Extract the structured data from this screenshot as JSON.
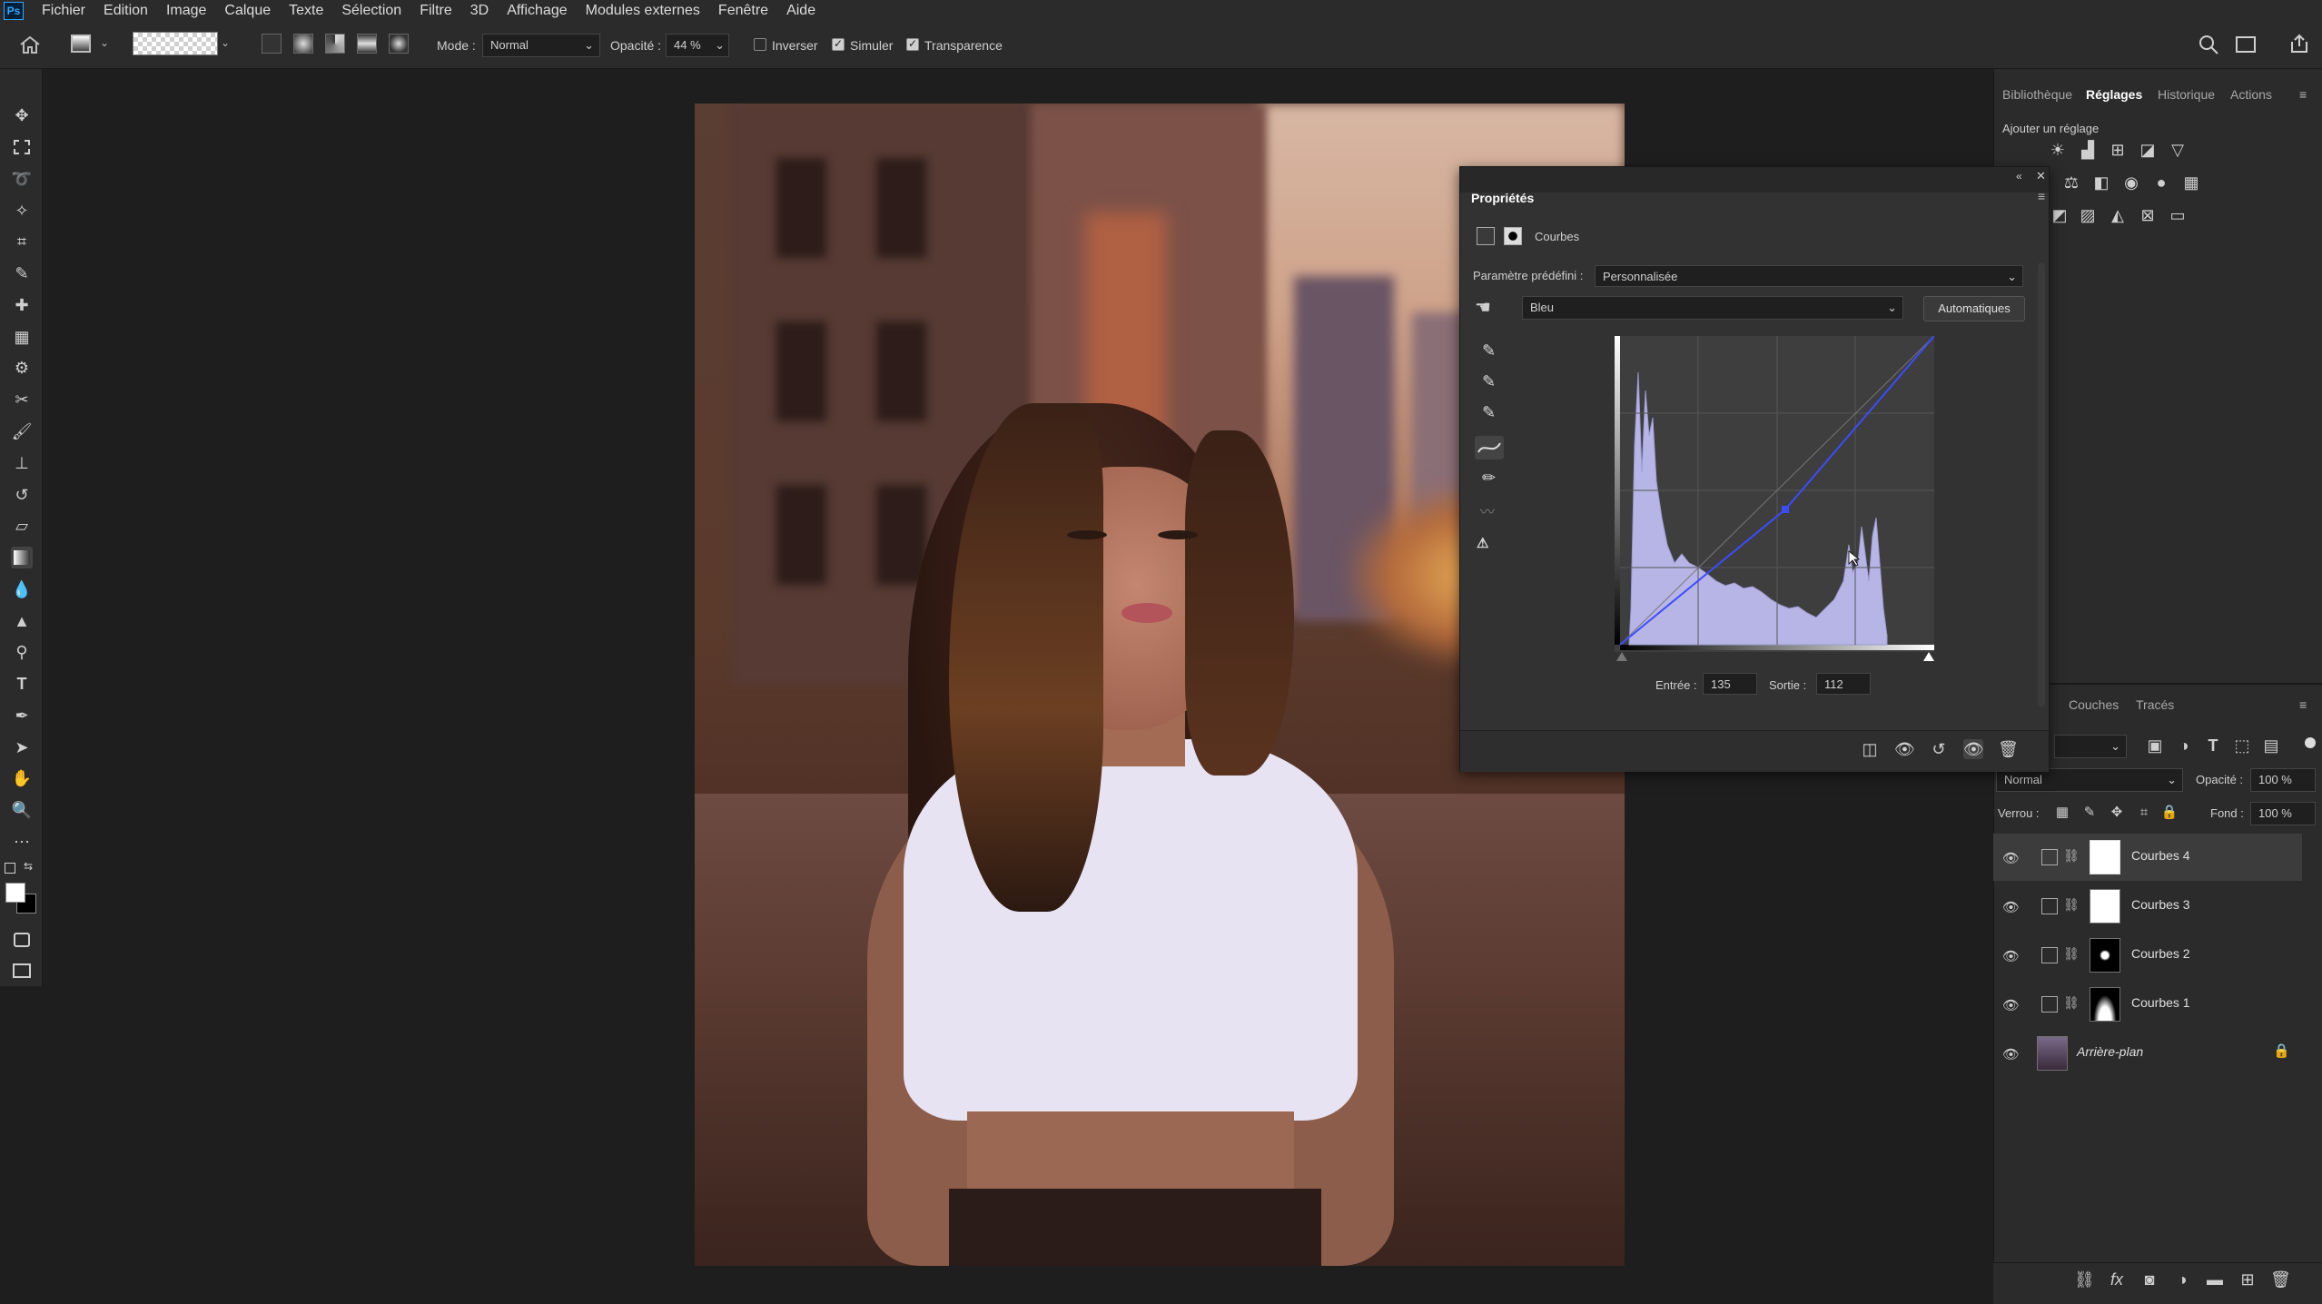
{
  "menubar": {
    "logo": "Ps",
    "items": [
      "Fichier",
      "Edition",
      "Image",
      "Calque",
      "Texte",
      "Sélection",
      "Filtre",
      "3D",
      "Affichage",
      "Modules externes",
      "Fenêtre",
      "Aide"
    ]
  },
  "options": {
    "mode_label": "Mode :",
    "mode_value": "Normal",
    "opacity_label": "Opacité :",
    "opacity_value": "44 %",
    "invert_label": "Inverser",
    "simulate_label": "Simuler",
    "transparency_label": "Transparence",
    "invert_checked": false,
    "simulate_checked": true,
    "transparency_checked": true
  },
  "right_panel": {
    "tabs": [
      "Bibliothèque",
      "Réglages",
      "Historique",
      "Actions"
    ],
    "active_tab": "Réglages",
    "add_adjustment": "Ajouter un réglage"
  },
  "properties": {
    "title": "Propriétés",
    "adjustment_name": "Courbes",
    "preset_label": "Paramètre prédéfini :",
    "preset_value": "Personnalisée",
    "channel_value": "Bleu",
    "auto_button": "Automatiques",
    "input_label": "Entrée :",
    "input_value": "135",
    "output_label": "Sortie :",
    "output_value": "112",
    "curve_point": {
      "input": 135,
      "output": 112
    }
  },
  "layers": {
    "tabs": [
      "Couches",
      "Tracés"
    ],
    "blend_mode": "Normal",
    "opacity_label": "Opacité :",
    "opacity_value": "100 %",
    "lock_label": "Verrou :",
    "fill_label": "Fond :",
    "fill_value": "100 %",
    "items": [
      {
        "name": "Courbes 4",
        "selected": true
      },
      {
        "name": "Courbes 3",
        "selected": false
      },
      {
        "name": "Courbes 2",
        "selected": false
      },
      {
        "name": "Courbes 1",
        "selected": false
      },
      {
        "name": "Arrière-plan",
        "selected": false,
        "locked": true
      }
    ]
  },
  "colors": {
    "accent": "#31a8ff",
    "panel_bg": "#2b2b2b",
    "curve_line": "#3b4cff",
    "histogram_fill": "#b7b5e6"
  }
}
